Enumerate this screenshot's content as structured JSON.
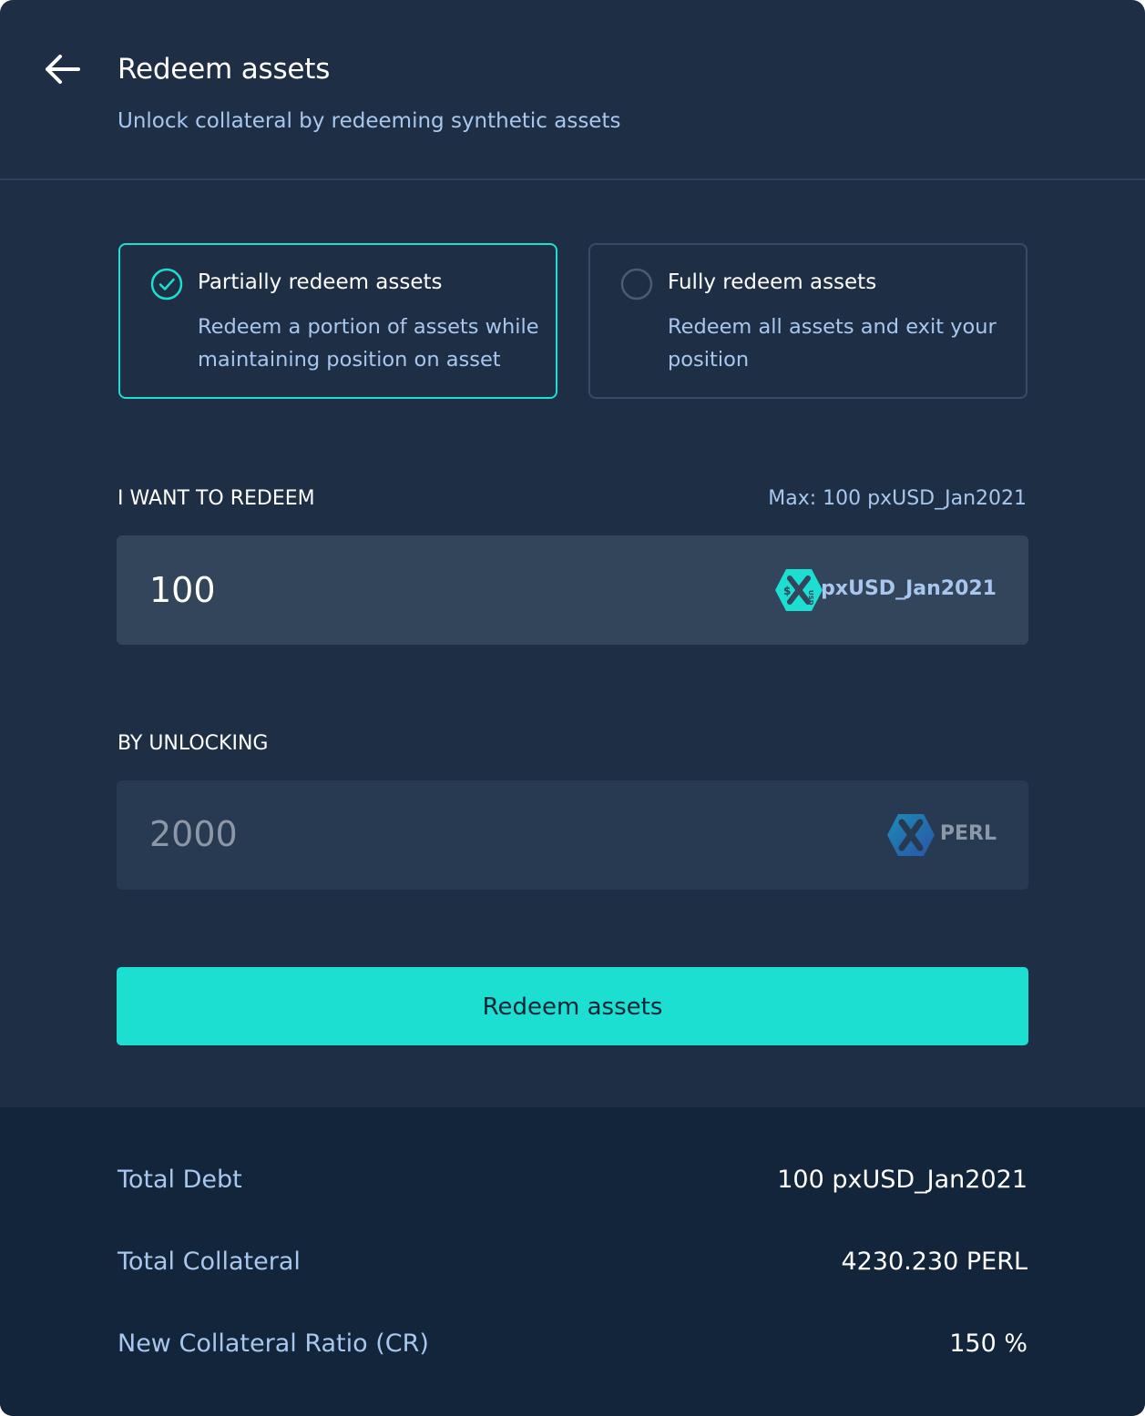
{
  "header": {
    "title": "Redeem assets",
    "subtitle": "Unlock collateral by redeeming synthetic assets"
  },
  "options": [
    {
      "title": "Partially redeem assets",
      "description": "Redeem a portion of assets while maintaining position on asset",
      "selected": true
    },
    {
      "title": "Fully redeem assets",
      "description": "Redeem all assets and exit your position",
      "selected": false
    }
  ],
  "redeem_section": {
    "label": "I WANT TO REDEEM",
    "max_label": "Max: 100 pxUSD_Jan2021",
    "amount": "100",
    "token_name": "pxUSD_Jan2021",
    "token_icon": "pxusd-token-icon"
  },
  "unlock_section": {
    "label": "BY UNLOCKING",
    "amount": "2000",
    "token_name": "PERL",
    "token_icon": "perl-token-icon"
  },
  "action": {
    "button_label": "Redeem assets"
  },
  "summary": {
    "rows": [
      {
        "label": "Total Debt",
        "value": "100 pxUSD_Jan2021"
      },
      {
        "label": "Total Collateral",
        "value": "4230.230 PERL"
      },
      {
        "label": "New Collateral Ratio (CR)",
        "value": "150 %"
      }
    ]
  },
  "colors": {
    "background": "#1e2e45",
    "accent": "#1cded1",
    "secondary_text": "#a8c7ee",
    "summary_background": "#13253a"
  }
}
